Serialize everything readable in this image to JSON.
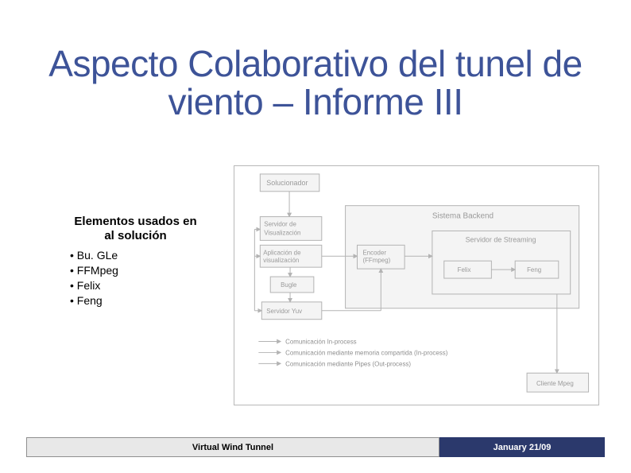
{
  "title": "Aspecto Colaborativo del tunel de viento – Informe III",
  "sidebar": {
    "heading": "Elementos usados en al solución",
    "items": [
      "Bu. GLe",
      "FFMpeg",
      "Felix",
      "Feng"
    ]
  },
  "diagram": {
    "boxes": {
      "solucionador": "Solucionador",
      "servidor_viz": "Servidor de Visualización",
      "aplicacion_viz": "Aplicación de visualización",
      "bugle": "Bugle",
      "servidor_yuv": "Servidor Yuv",
      "backend_group": "Sistema Backend",
      "encoder": "Encoder (FFmpeg)",
      "streaming": "Servidor de Streaming",
      "felix": "Felix",
      "feng": "Feng",
      "cliente": "Cliente Mpeg"
    },
    "legend": [
      "Comunicación In-process",
      "Comunicación mediante memoria compartida (In-process)",
      "Comunicación mediante Pipes (Out-process)"
    ]
  },
  "footer": {
    "left": "Virtual Wind Tunnel",
    "right": "January 21/09"
  }
}
